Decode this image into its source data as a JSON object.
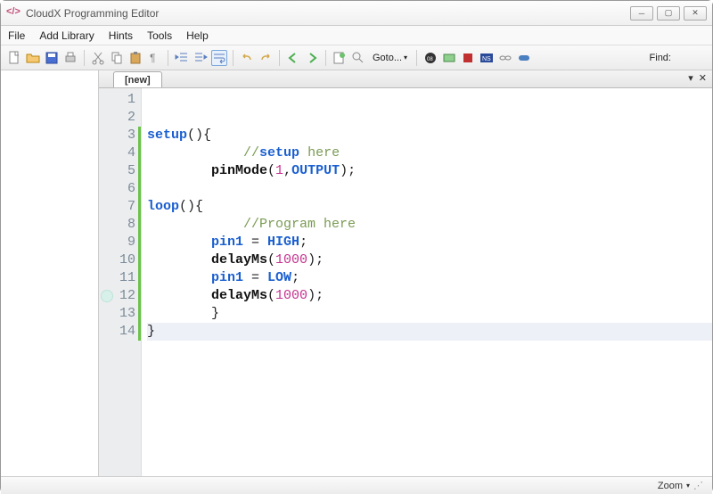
{
  "window": {
    "title": "CloudX Programming Editor"
  },
  "menu": {
    "file": "File",
    "addlib": "Add Library",
    "hints": "Hints",
    "tools": "Tools",
    "help": "Help"
  },
  "toolbar": {
    "goto": "Goto...",
    "find": "Find:"
  },
  "tab": {
    "name": "[new]"
  },
  "status": {
    "zoom": "Zoom"
  },
  "code": {
    "lines": [
      "",
      "",
      "setup(){",
      "            //setup here",
      "        pinMode(1,OUTPUT);",
      "",
      "loop(){",
      "            //Program here",
      "        pin1 = HIGH;",
      "        delayMs(1000);",
      "        pin1 = LOW;",
      "        delayMs(1000);",
      "        }",
      "}"
    ],
    "current_line": 14,
    "greenbar_start": 3,
    "greenbar_end": 14,
    "marker_line": 12
  }
}
